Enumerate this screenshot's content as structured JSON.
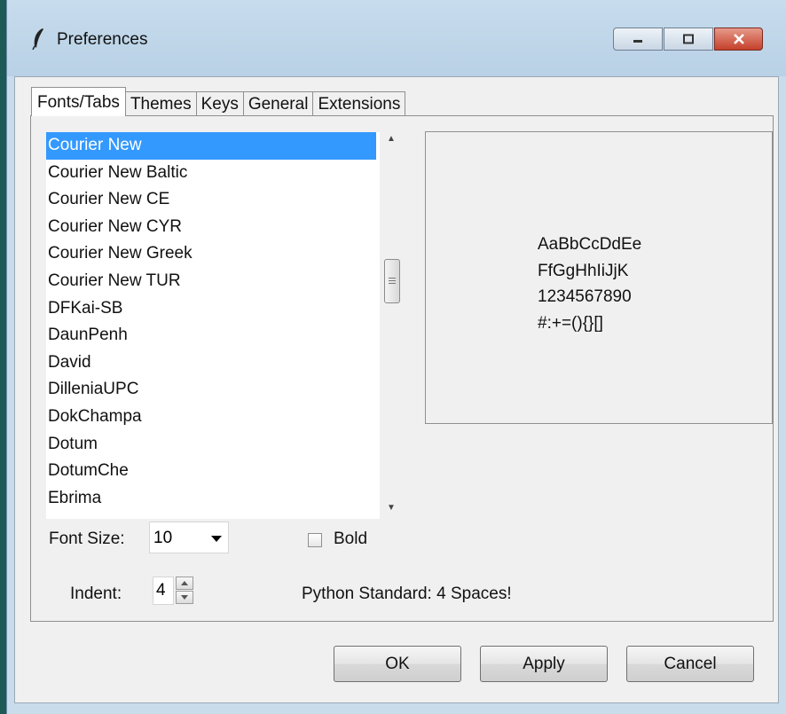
{
  "window": {
    "title": "Preferences",
    "colors": {
      "titlebar": "#c7dced",
      "selection": "#3399ff",
      "close_button": "#c4402a"
    }
  },
  "tabs": [
    {
      "label": "Fonts/Tabs",
      "active": true
    },
    {
      "label": "Themes",
      "active": false
    },
    {
      "label": "Keys",
      "active": false
    },
    {
      "label": "General",
      "active": false
    },
    {
      "label": "Extensions",
      "active": false
    }
  ],
  "font_list": {
    "selected_index": 0,
    "items": [
      "Courier New",
      "Courier New Baltic",
      "Courier New CE",
      "Courier New CYR",
      "Courier New Greek",
      "Courier New TUR",
      "DFKai-SB",
      "DaunPenh",
      "David",
      "DilleniaUPC",
      "DokChampa",
      "Dotum",
      "DotumChe",
      "Ebrima"
    ]
  },
  "sample": {
    "lines": [
      "AaBbCcDdEe",
      "FfGgHhIiJjK",
      "1234567890",
      "#:+=(){}[]"
    ]
  },
  "font_size": {
    "label": "Font Size:",
    "value": "10"
  },
  "bold": {
    "label": "Bold",
    "checked": false
  },
  "indent": {
    "label": "Indent:",
    "value": "4",
    "note": "Python Standard: 4 Spaces!"
  },
  "buttons": {
    "ok": "OK",
    "apply": "Apply",
    "cancel": "Cancel"
  }
}
